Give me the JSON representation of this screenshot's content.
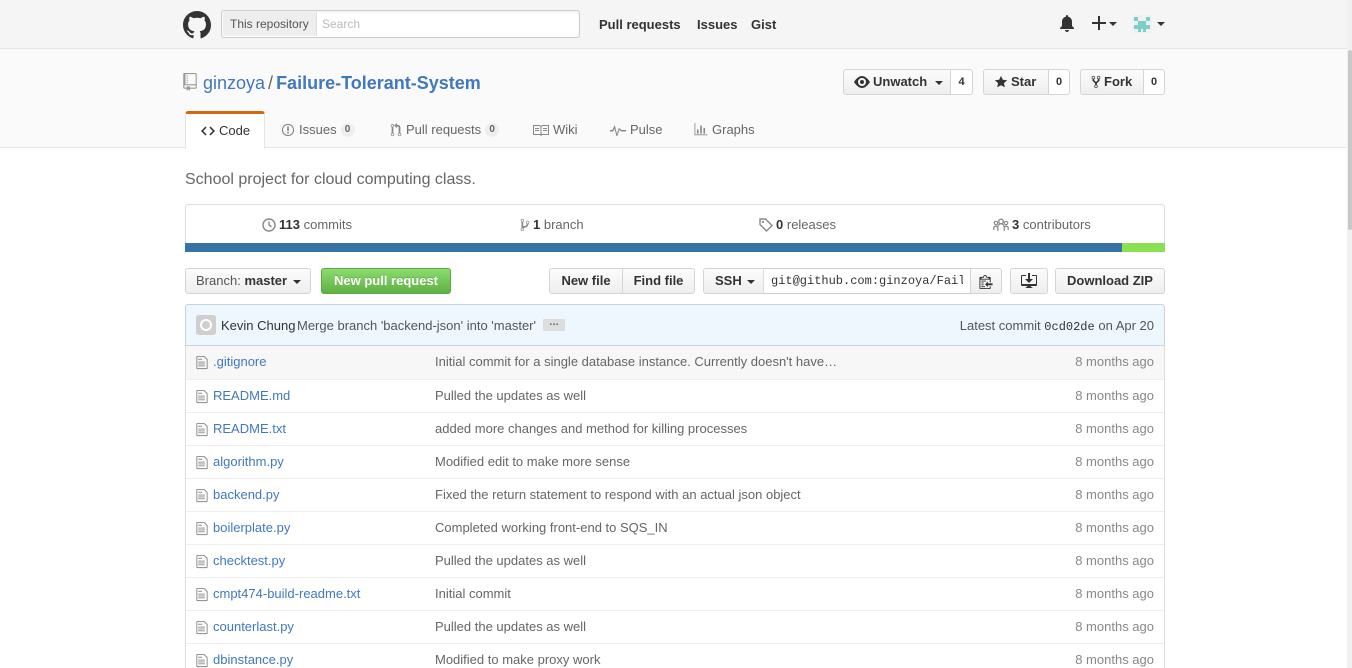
{
  "header": {
    "search_scope": "This repository",
    "search_placeholder": "Search",
    "nav": [
      "Pull requests",
      "Issues",
      "Gist"
    ],
    "icons": [
      "bell-icon",
      "plus-icon",
      "avatar-icon"
    ]
  },
  "repo": {
    "owner": "ginzoya",
    "separator": "/",
    "name": "Failure-Tolerant-System",
    "unwatch_label": "Unwatch",
    "watch_count": "4",
    "star_label": "Star",
    "star_count": "0",
    "fork_label": "Fork",
    "fork_count": "0"
  },
  "tabs": {
    "code": "Code",
    "issues": "Issues",
    "issues_count": "0",
    "pulls": "Pull requests",
    "pulls_count": "0",
    "wiki": "Wiki",
    "pulse": "Pulse",
    "graphs": "Graphs"
  },
  "description": "School project for cloud computing class.",
  "summary": {
    "commits_count": "113",
    "commits_label": "commits",
    "branches_count": "1",
    "branches_label": "branch",
    "releases_count": "0",
    "releases_label": "releases",
    "contributors_count": "3",
    "contributors_label": "contributors"
  },
  "language_bar": [
    {
      "color": "#3572a5",
      "share": 0.956
    },
    {
      "color": "#89e051",
      "share": 0.044
    }
  ],
  "toolbar": {
    "branch_prefix": "Branch:",
    "branch_name": "master",
    "new_pull_request": "New pull request",
    "new_file": "New file",
    "find_file": "Find file",
    "clone_protocol": "SSH",
    "clone_url": "git@github.com:ginzoya/Failure-Tolerant-System.git",
    "download_zip": "Download ZIP"
  },
  "latest_commit": {
    "author": "Kevin Chung",
    "message": "Merge branch 'backend-json' into 'master'",
    "ellipsis": "…",
    "prefix": "Latest commit",
    "sha": "0cd02de",
    "date": "on Apr 20"
  },
  "files": [
    {
      "name": ".gitignore",
      "message": "Initial commit for a single database instance. Currently doesn't have…",
      "age": "8 months ago"
    },
    {
      "name": "README.md",
      "message": "Pulled the updates as well",
      "age": "8 months ago"
    },
    {
      "name": "README.txt",
      "message": "added more changes and method for killing processes",
      "age": "8 months ago"
    },
    {
      "name": "algorithm.py",
      "message": "Modified edit to make more sense",
      "age": "8 months ago"
    },
    {
      "name": "backend.py",
      "message": "Fixed the return statement to respond with an actual json object",
      "age": "8 months ago"
    },
    {
      "name": "boilerplate.py",
      "message": "Completed working front-end to SQS_IN",
      "age": "8 months ago"
    },
    {
      "name": "checktest.py",
      "message": "Pulled the updates as well",
      "age": "8 months ago"
    },
    {
      "name": "cmpt474-build-readme.txt",
      "message": "Initial commit",
      "age": "8 months ago"
    },
    {
      "name": "counterlast.py",
      "message": "Pulled the updates as well",
      "age": "8 months ago"
    },
    {
      "name": "dbinstance.py",
      "message": "Modified to make proxy work",
      "age": "8 months ago"
    }
  ]
}
